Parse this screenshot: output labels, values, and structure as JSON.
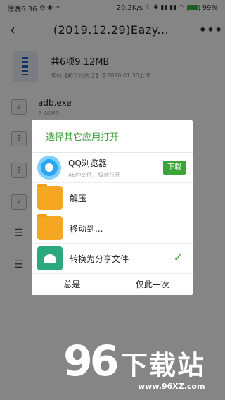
{
  "statusbar": {
    "time": "傍晚6:36",
    "speed": "20.2K/s",
    "battery": "99%"
  },
  "header": {
    "title": "(2019.12.29)Eazy...",
    "back_label": "‹",
    "more_label": "•••"
  },
  "summary": {
    "title": "共6项9.12MB",
    "subtitle": "昨莉【初三代死了】于2020.01.30上传"
  },
  "files": [
    {
      "name": "adb.exe",
      "size": "2.46MB"
    }
  ],
  "dialog": {
    "title": "选择其它应用打开",
    "options": [
      {
        "label": "QQ浏览器",
        "sub": "46种文件，极速打开",
        "button": "下载"
      },
      {
        "label": "解压"
      },
      {
        "label": "移动到..."
      },
      {
        "label": "转换为分享文件",
        "check": "✓"
      }
    ],
    "buttons": {
      "always": "总是",
      "once": "仅此一次"
    }
  },
  "watermark": {
    "number": "96",
    "name": "下载站",
    "url": "www.96XZ.com"
  }
}
